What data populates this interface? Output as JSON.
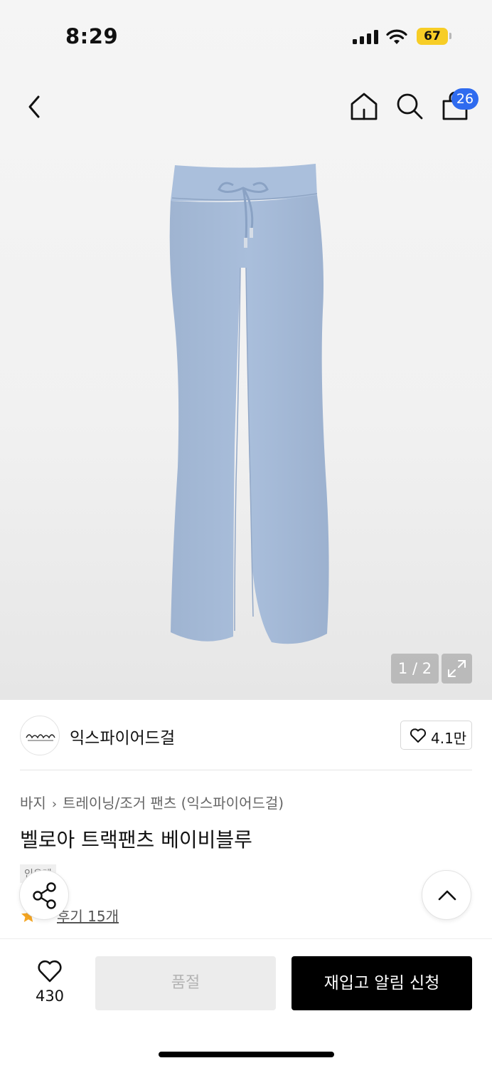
{
  "status_bar": {
    "time": "8:29",
    "battery": "67",
    "icons": [
      "cellular-signal-icon",
      "wifi-icon",
      "battery-icon"
    ]
  },
  "nav": {
    "icons": [
      "back-chevron-icon",
      "home-icon",
      "search-icon",
      "shopping-bag-icon"
    ],
    "cart_count": "26"
  },
  "gallery": {
    "pager": "1 / 2",
    "image_color": "#a7bcd8",
    "icons": [
      "expand-icon"
    ]
  },
  "brand": {
    "name": "익스파이어드걸",
    "likes": "4.1만",
    "icons": [
      "heart-outline-icon"
    ]
  },
  "breadcrumb": {
    "category": "바지",
    "subcategory": "트레이닝/조거 팬츠 (익스파이어드걸)"
  },
  "product": {
    "title": "벨로아 트랙팬츠 베이비블루",
    "tag": "인유레",
    "reviews": "후기 15개"
  },
  "floating": {
    "icons": [
      "share-icon",
      "chevron-up-icon",
      "star-icon"
    ]
  },
  "bottom_bar": {
    "wish_count": "430",
    "soldout_label": "품절",
    "restock_label": "재입고 알림 신청"
  },
  "colors": {
    "accent_badge": "#2f6bef",
    "battery": "#f7cd26",
    "primary_button": "#000000",
    "disabled_button": "#ececec",
    "star": "#f5a623"
  }
}
